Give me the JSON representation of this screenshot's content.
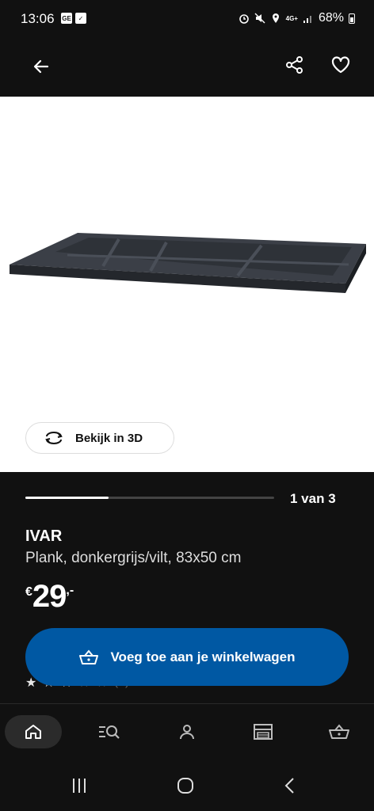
{
  "status_bar": {
    "time": "13:06",
    "battery": "68%",
    "network": "4G+"
  },
  "gallery": {
    "view_3d_label": "Bekijk in 3D",
    "counter": "1 van 3",
    "progress": 0.333
  },
  "product": {
    "brand": "IVAR",
    "description": "Plank, donkergrijs/vilt, 83x50 cm",
    "price_currency": "€",
    "price_value": "29",
    "price_suffix": ",-",
    "rating_count": "(2)"
  },
  "actions": {
    "add_to_cart_label": "Voeg toe aan je winkelwagen"
  },
  "colors": {
    "background": "#111111",
    "accent_blue": "#0058a3",
    "image_bg": "#ffffff"
  },
  "icons": {
    "back": "arrow-left-icon",
    "share": "share-icon",
    "favourite": "heart-icon",
    "view_3d": "rotate-3d-icon",
    "cart": "basket-icon",
    "nav_home": "home-icon",
    "nav_search": "search-list-icon",
    "nav_account": "person-icon",
    "nav_store": "store-icon",
    "nav_basket": "basket-icon"
  }
}
